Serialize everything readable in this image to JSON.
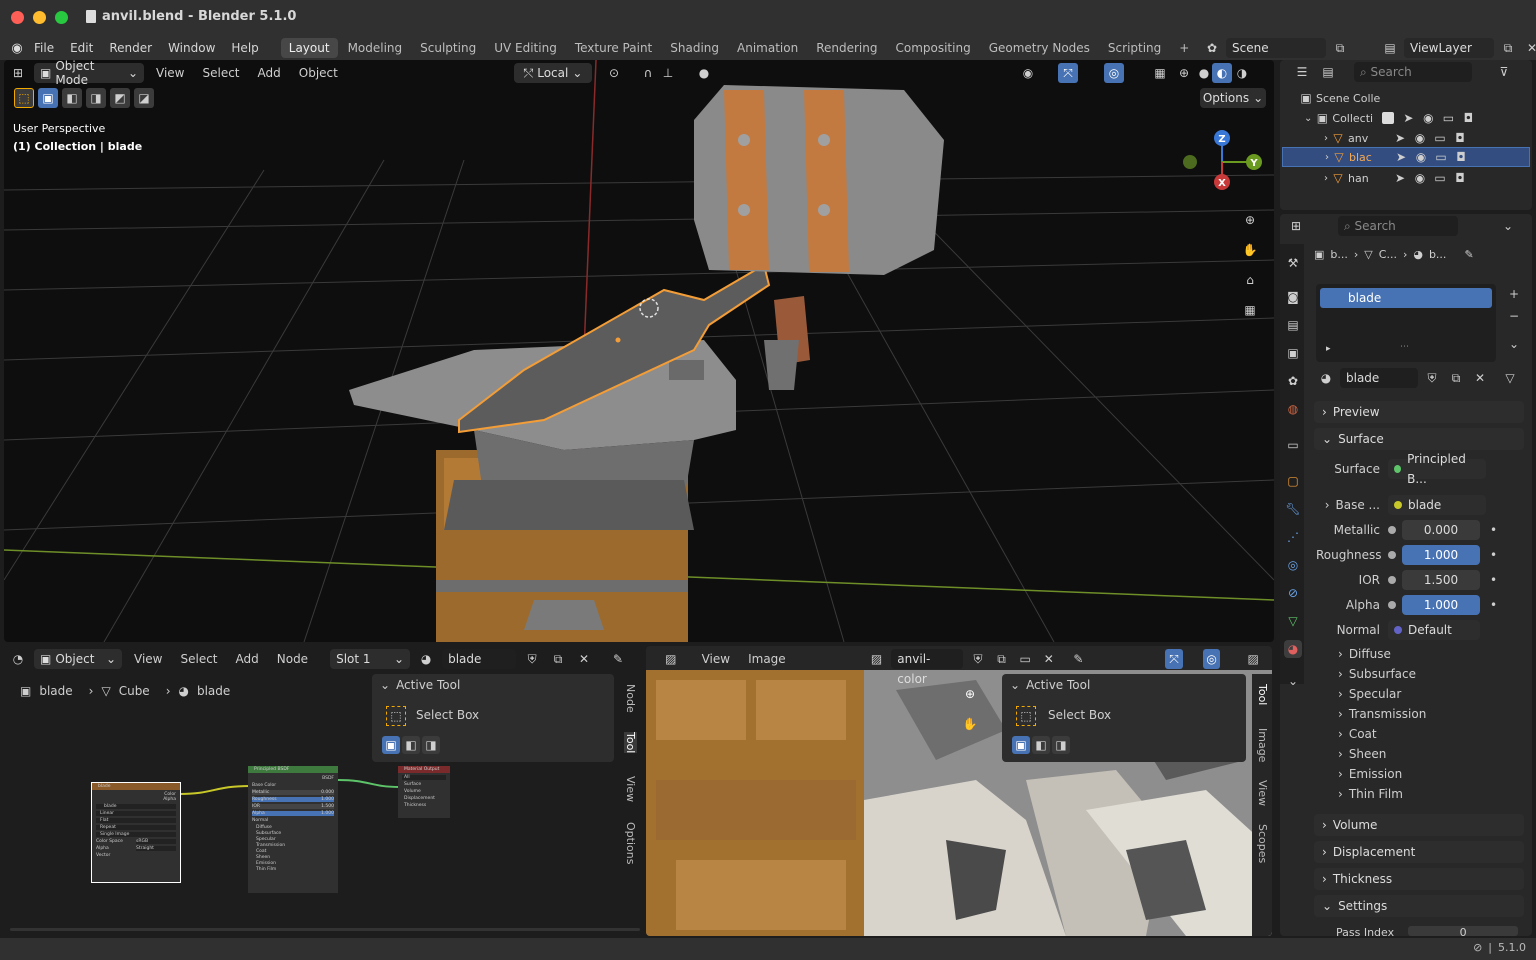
{
  "window": {
    "title": "anvil.blend - Blender 5.1.0"
  },
  "menu": {
    "items": [
      "File",
      "Edit",
      "Render",
      "Window",
      "Help"
    ]
  },
  "workspaces": [
    "Layout",
    "Modeling",
    "Sculpting",
    "UV Editing",
    "Texture Paint",
    "Shading",
    "Animation",
    "Rendering",
    "Compositing",
    "Geometry Nodes",
    "Scripting"
  ],
  "scene": {
    "name": "Scene",
    "viewlayer": "ViewLayer"
  },
  "viewport": {
    "mode": "Object Mode",
    "menus": [
      "View",
      "Select",
      "Add",
      "Object"
    ],
    "orientation": "Local",
    "options_label": "Options",
    "overlay_title": "User Perspective",
    "overlay_sub": "(1) Collection | blade",
    "axes": {
      "z": "Z",
      "y": "Y",
      "x": "X"
    }
  },
  "outliner": {
    "search_placeholder": "Search",
    "scene_collection": "Scene Colle",
    "collection": "Collecti",
    "items": [
      "anv",
      "blac",
      "han"
    ]
  },
  "properties": {
    "search_placeholder": "Search",
    "breadcrumb": [
      "b...",
      "C...",
      "b..."
    ],
    "slot_name": "blade",
    "material_name": "blade",
    "panels": {
      "preview": "Preview",
      "surface": "Surface",
      "volume": "Volume",
      "displacement": "Displacement",
      "thickness": "Thickness",
      "settings": "Settings"
    },
    "surface_label": "Surface",
    "surface_value": "Principled B...",
    "base_label": "Base ...",
    "base_value": "blade",
    "metallic_label": "Metallic",
    "metallic": "0.000",
    "roughness_label": "Roughness",
    "roughness": "1.000",
    "ior_label": "IOR",
    "ior": "1.500",
    "alpha_label": "Alpha",
    "alpha": "1.000",
    "normal_label": "Normal",
    "normal": "Default",
    "subpanels": [
      "Diffuse",
      "Subsurface",
      "Specular",
      "Transmission",
      "Coat",
      "Sheen",
      "Emission",
      "Thin Film"
    ],
    "pass_index": "Pass Index",
    "pass_value": "0"
  },
  "node_editor": {
    "mode": "Object",
    "menus": [
      "View",
      "Select",
      "Add",
      "Node"
    ],
    "slot": "Slot 1",
    "material": "blade",
    "breadcrumb": [
      "blade",
      "Cube",
      "blade"
    ],
    "active_tool": "Active Tool",
    "tool_name": "Select Box",
    "tabs": [
      "Node",
      "Tool",
      "View",
      "Options"
    ],
    "nodes": {
      "image": {
        "title": "blade",
        "output1": "Color",
        "output2": "Alpha",
        "field": "blade",
        "rows": [
          "Linear",
          "Flat",
          "Repeat",
          "Single Image",
          "Color Space",
          "Alpha"
        ],
        "vals": [
          "",
          "",
          "",
          "",
          "sRGB",
          "Straight"
        ],
        "vector": "Vector"
      },
      "bsdf": {
        "title": "Principled BSDF",
        "out": "BSDF",
        "rows": [
          "Base Color",
          "Metallic",
          "Roughness",
          "IOR",
          "Alpha",
          "Normal"
        ],
        "vals": [
          "",
          "0.000",
          "1.000",
          "1.500",
          "1.000",
          ""
        ],
        "subs": [
          "Diffuse",
          "Subsurface",
          "Specular",
          "Transmission",
          "Coat",
          "Sheen",
          "Emission",
          "Thin Film"
        ]
      },
      "output": {
        "title": "Material Output",
        "field": "All",
        "rows": [
          "Surface",
          "Volume",
          "Displacement",
          "Thickness"
        ]
      }
    }
  },
  "image_editor": {
    "menus": [
      "View",
      "Image"
    ],
    "image": "anvil-color",
    "active_tool": "Active Tool",
    "tool_name": "Select Box",
    "tabs": [
      "Tool",
      "Image",
      "View",
      "Scopes"
    ]
  },
  "status": {
    "version": "5.1.0"
  },
  "colors": {
    "accent": "#4772b3",
    "select_orange": "#f29d38",
    "bg": "#1d1d1d"
  }
}
